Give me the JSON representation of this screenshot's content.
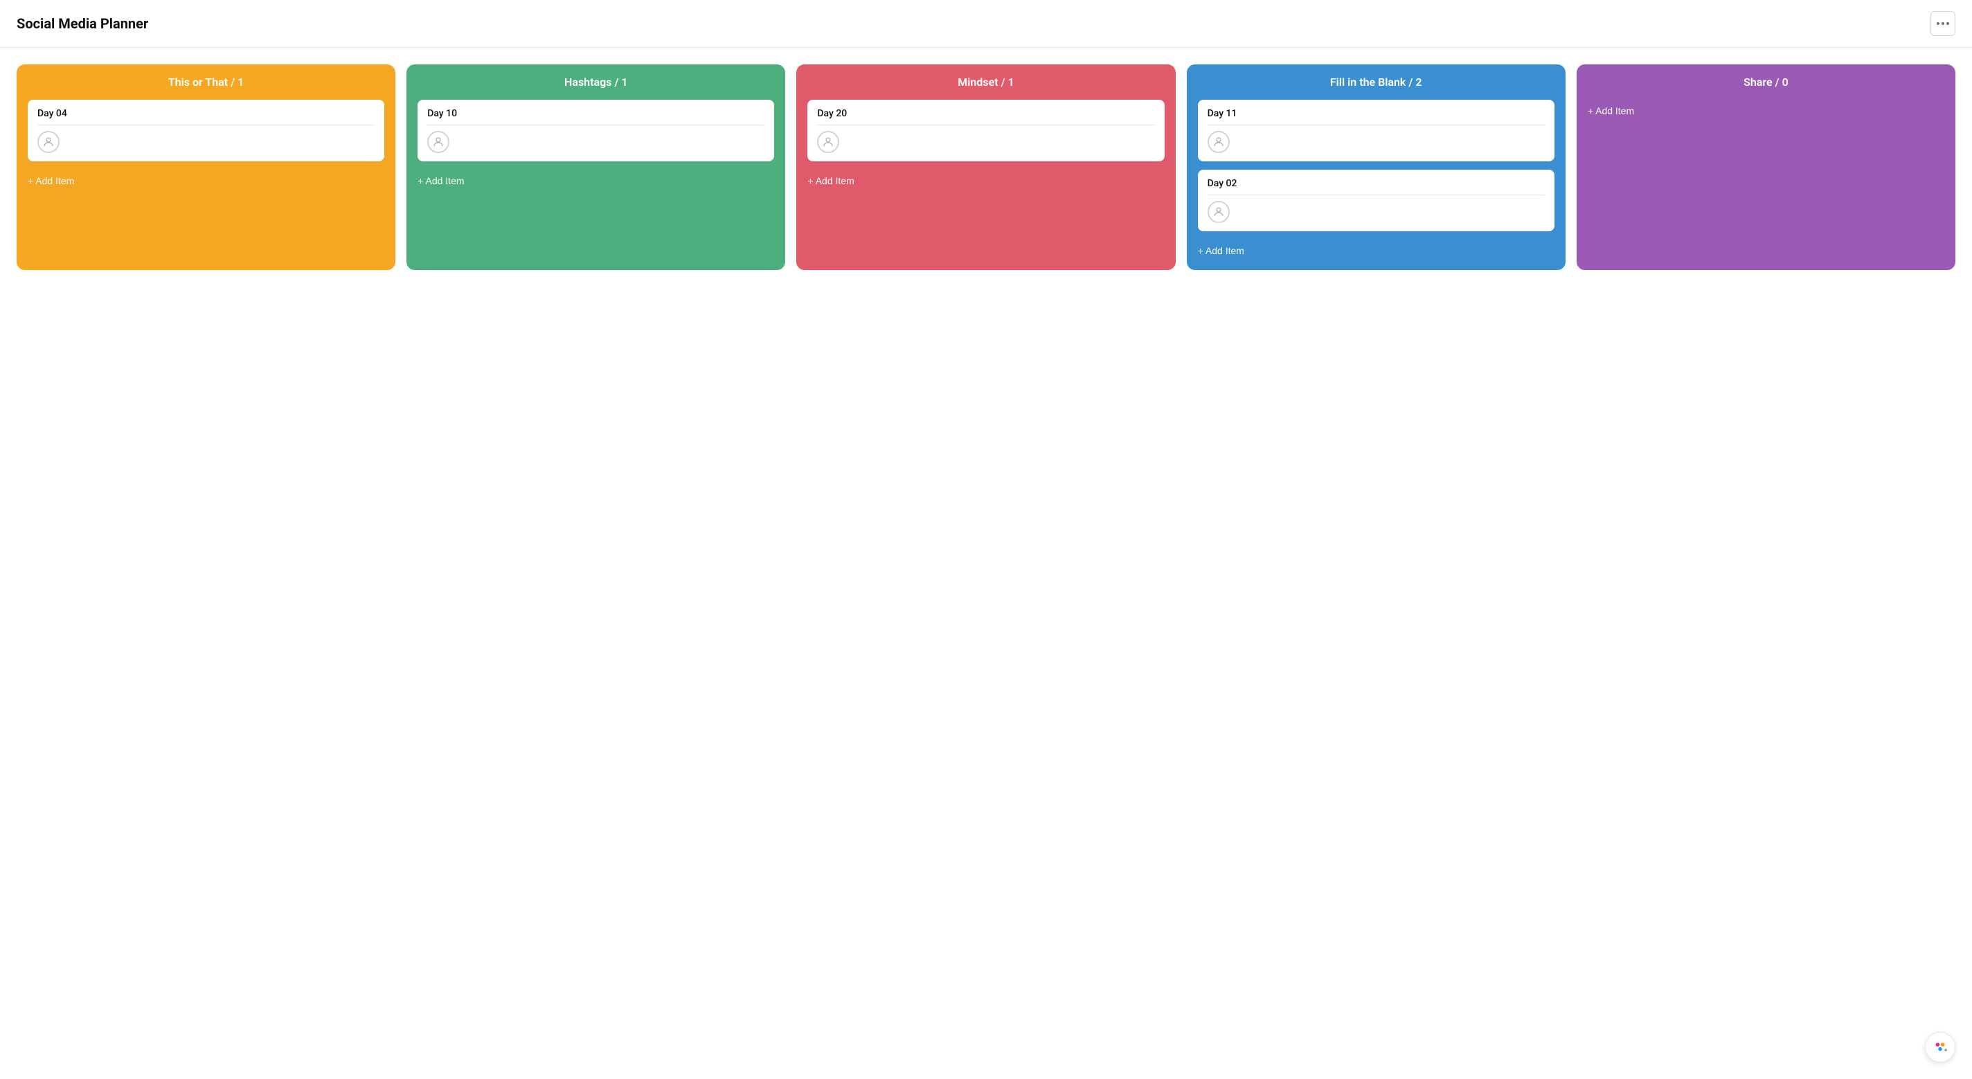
{
  "app": {
    "title": "Social Media Planner"
  },
  "header": {
    "more_label": "···"
  },
  "columns": [
    {
      "id": "this-or-that",
      "label": "This or That / 1",
      "color_class": "col-orange",
      "cards": [
        {
          "id": "card-1",
          "title": "Day 04"
        }
      ],
      "add_item_label": "+ Add Item"
    },
    {
      "id": "hashtags",
      "label": "Hashtags / 1",
      "color_class": "col-green",
      "cards": [
        {
          "id": "card-2",
          "title": "Day 10"
        }
      ],
      "add_item_label": "+ Add Item"
    },
    {
      "id": "mindset",
      "label": "Mindset / 1",
      "color_class": "col-red",
      "cards": [
        {
          "id": "card-3",
          "title": "Day 20"
        }
      ],
      "add_item_label": "+ Add Item"
    },
    {
      "id": "fill-in-the-blank",
      "label": "Fill in the Blank / 2",
      "color_class": "col-blue",
      "cards": [
        {
          "id": "card-4",
          "title": "Day 11"
        },
        {
          "id": "card-5",
          "title": "Day 02"
        }
      ],
      "add_item_label": "+ Add Item"
    },
    {
      "id": "share",
      "label": "Share / 0",
      "color_class": "col-purple",
      "cards": [],
      "add_item_label": "+ Add Item"
    }
  ],
  "fab": {
    "icon": "✦+"
  }
}
